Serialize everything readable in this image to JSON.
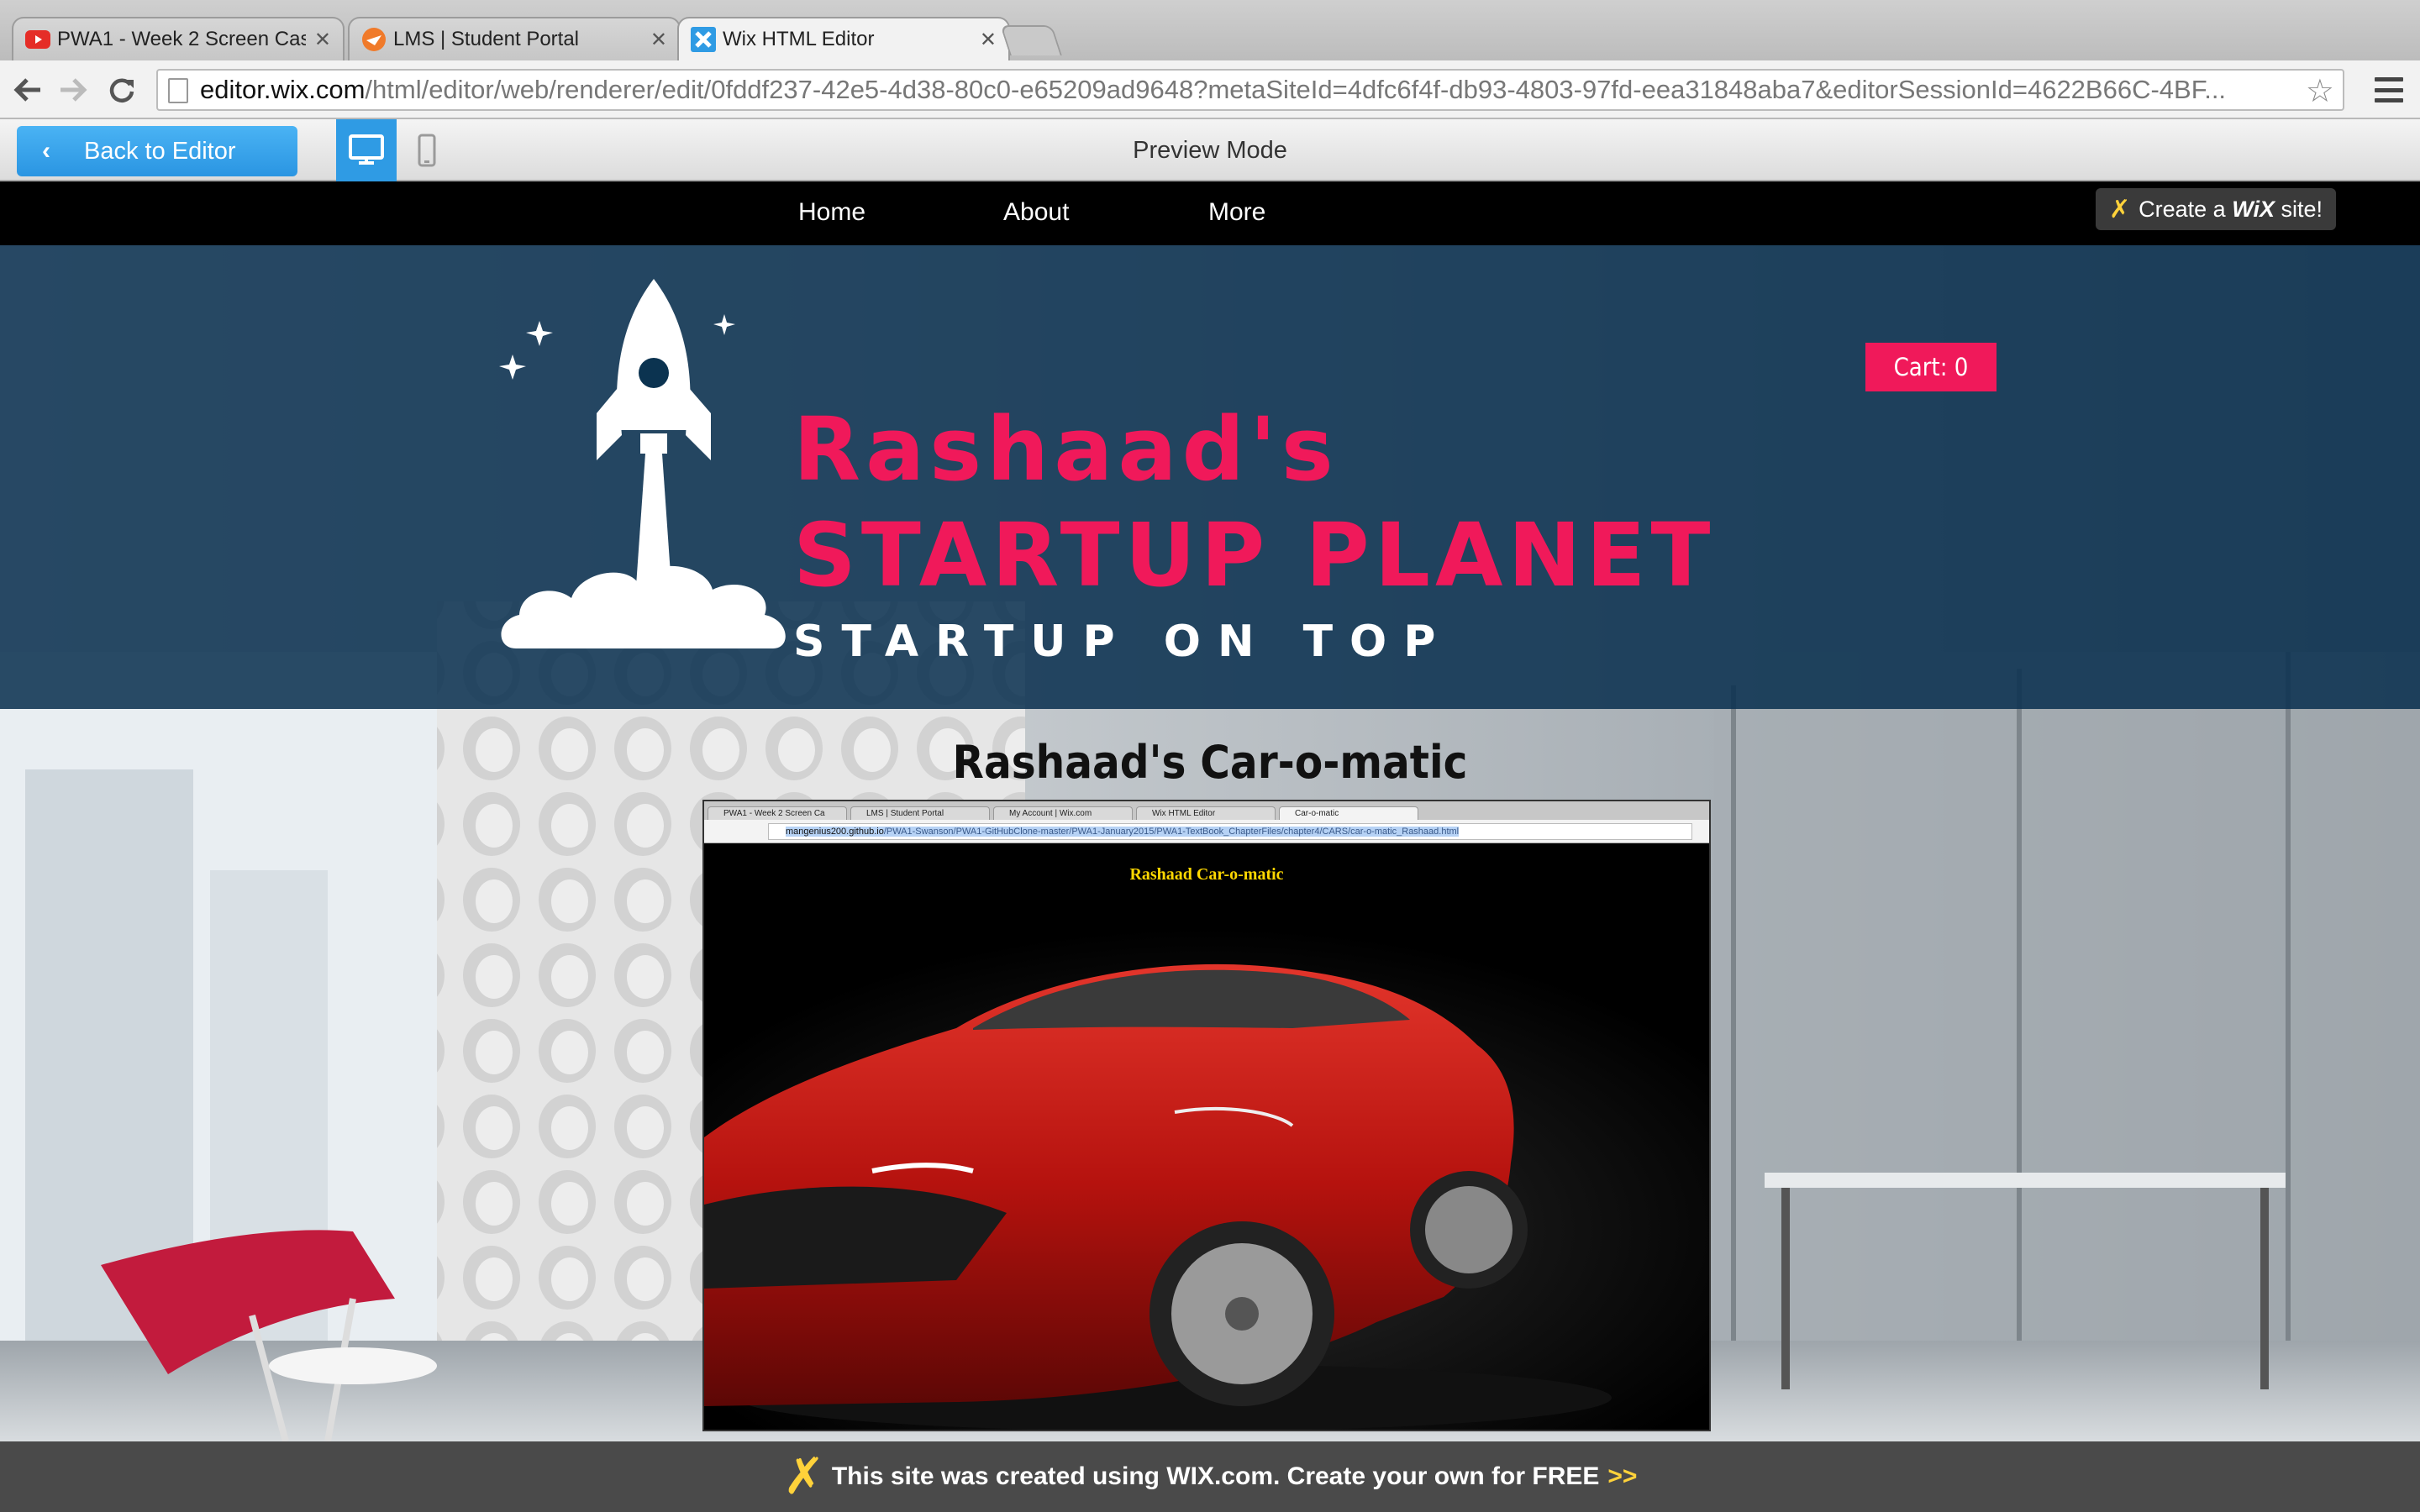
{
  "browser": {
    "tabs": [
      {
        "title": "PWA1 - Week 2 Screen Cas",
        "icon": "youtube-icon",
        "active": false
      },
      {
        "title": "LMS | Student Portal",
        "icon": "lms-icon",
        "active": false
      },
      {
        "title": "Wix HTML Editor",
        "icon": "wix-icon",
        "active": true
      }
    ],
    "url_domain": "editor.wix.com",
    "url_path": "/html/editor/web/renderer/edit/0fddf237-42e5-4d38-80c0-e65209ad9648?metaSiteId=4dfc6f4f-db93-4803-97fd-eea31848aba7&editorSessionId=4622B66C-4BF..."
  },
  "wix_bar": {
    "back_label": "Back to Editor",
    "mode_label": "Preview Mode"
  },
  "site": {
    "nav": [
      "Home",
      "About",
      "More"
    ],
    "create_site": {
      "prefix": "Create a",
      "brand": "WiX",
      "suffix": "site!"
    },
    "cart_label": "Cart: 0",
    "logo_line1": "Rashaad's",
    "logo_line2": "STARTUP PLANET",
    "tagline": "STARTUP ON TOP",
    "content_title": "Rashaad's Car-o-matic",
    "footer_text": "This site was created using WIX.com. Create your own for FREE",
    "footer_arrows": ">>"
  },
  "embedded_screenshot": {
    "tabs": [
      "PWA1 - Week 2 Screen Ca",
      "LMS | Student Portal",
      "My Account | Wix.com",
      "Wix HTML Editor",
      "Car-o-matic"
    ],
    "url_host": "mangenius200.github.io",
    "url_path": "/PWA1-Swanson/PWA1-GitHubClone-master/PWA1-January2015/PWA1-TextBook_ChapterFiles/chapter4/CARS/car-o-matic_Rashaad.html",
    "page_title": "Rashaad Car-o-matic"
  },
  "colors": {
    "accent_pink": "#f0195a",
    "wix_blue": "#2f9be4",
    "hero_overlay": "#082e4e",
    "car_title_yellow": "#ffd800",
    "footer_bg": "#4a4a4a"
  }
}
